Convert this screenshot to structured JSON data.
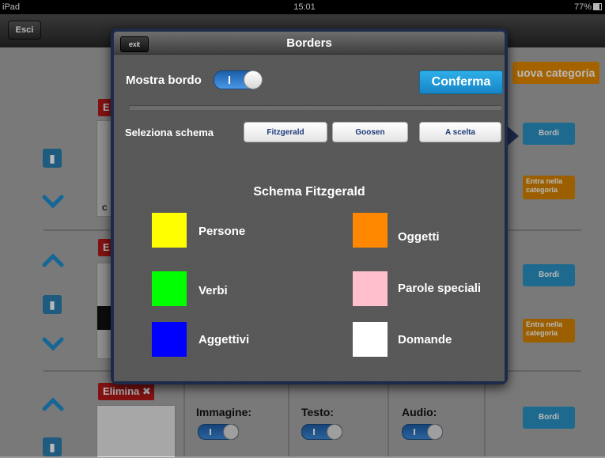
{
  "status": {
    "device": "iPad",
    "time": "15:01",
    "battery": "77%"
  },
  "navbar": {
    "esci_label": "Esci"
  },
  "background": {
    "nuova_categoria": "uova categoria",
    "bordi_label": "Bordi",
    "entra_label": "Entra nella categoria",
    "elimina_label": "Elimina",
    "immagine_label": "Immagine:",
    "testo_label": "Testo:",
    "audio_label": "Audio:",
    "red_letter": "E",
    "caption_letter": "C"
  },
  "popover": {
    "title": "Borders",
    "exit_label": "exit",
    "mostra_bordo": "Mostra bordo",
    "conferma": "Conferma",
    "seleziona_schema": "Seleziona schema",
    "schemes": [
      "Fitzgerald",
      "Goosen",
      "A scelta"
    ],
    "schema_title": "Schema Fitzgerald",
    "categories": [
      {
        "label": "Persone",
        "color": "#ffff00"
      },
      {
        "label": "Oggetti",
        "color": "#ff8800"
      },
      {
        "label": "Verbi",
        "color": "#00ff00"
      },
      {
        "label": "Parole speciali",
        "color": "#ffc0cb"
      },
      {
        "label": "Aggettivi",
        "color": "#0000ff"
      },
      {
        "label": "Domande",
        "color": "#ffffff"
      }
    ]
  }
}
